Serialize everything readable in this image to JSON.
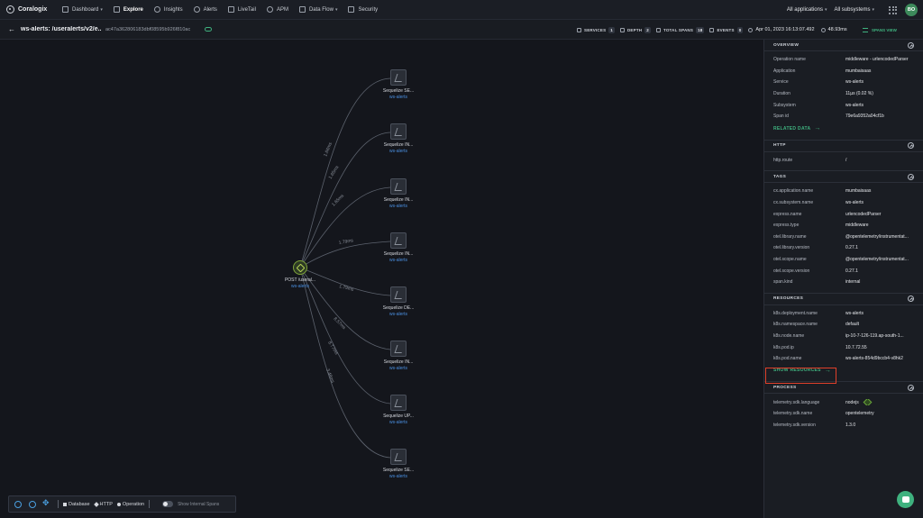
{
  "nav": {
    "logo": "Coralogix",
    "items": [
      {
        "label": "Dashboard",
        "caret": "▾",
        "icon": "grid-icon",
        "active": false
      },
      {
        "label": "Explore",
        "caret": "",
        "icon": "explore-icon",
        "active": true
      },
      {
        "label": "Insights",
        "caret": "",
        "icon": "insights-icon",
        "active": false
      },
      {
        "label": "Alerts",
        "caret": "",
        "icon": "bell-icon",
        "active": false
      },
      {
        "label": "LiveTail",
        "caret": "",
        "icon": "livetail-icon",
        "active": false
      },
      {
        "label": "APM",
        "caret": "",
        "icon": "apm-icon",
        "active": false
      },
      {
        "label": "Data Flow",
        "caret": "▾",
        "icon": "dataflow-icon",
        "active": false
      },
      {
        "label": "Security",
        "caret": "",
        "icon": "shield-icon",
        "active": false
      }
    ],
    "applications": "All applications",
    "subsystems": "All subsystems",
    "avatar": "BO"
  },
  "subbar": {
    "title": "ws-alerts: /useralerts/v2/e...",
    "trace_id": "ac47a362806183dbf08595b926f810ac",
    "services_label": "SERVICES",
    "services_count": "1",
    "depth_label": "DEPTH",
    "depth_count": "2",
    "spans_label": "TOTAL SPANS",
    "spans_count": "18",
    "events_label": "EVENTS",
    "events_count": "0",
    "timestamp": "Apr 01, 2023 16:13:07.492",
    "duration": "48.93ms",
    "spans_view": "SPANS VIEW"
  },
  "graph": {
    "root": {
      "name": "POST /useral...",
      "service": "ws-alerts"
    },
    "children": [
      {
        "name": "Sequelize SE...",
        "service": "ws-alerts",
        "edge_label": "1.66ms"
      },
      {
        "name": "Sequelize IN...",
        "service": "ws-alerts",
        "edge_label": "1.65ms"
      },
      {
        "name": "Sequelize IN...",
        "service": "ws-alerts",
        "edge_label": "1.65ms"
      },
      {
        "name": "Sequelize IN...",
        "service": "ws-alerts",
        "edge_label": "1.79ms"
      },
      {
        "name": "Sequelize DE...",
        "service": "ws-alerts",
        "edge_label": "1.79ms"
      },
      {
        "name": "Sequelize IN...",
        "service": "ws-alerts",
        "edge_label": "8.57ms"
      },
      {
        "name": "Sequelize UP...",
        "service": "ws-alerts",
        "edge_label": "8.77ms"
      },
      {
        "name": "Sequelize SE...",
        "service": "ws-alerts",
        "edge_label": "3.48ms"
      }
    ]
  },
  "toolbar": {
    "legend_database": "Database",
    "legend_http": "HTTP",
    "legend_operation": "Operation",
    "toggle_label": "Show Internal Spans"
  },
  "panel": {
    "overview": {
      "title": "OVERVIEW",
      "rows": [
        {
          "k": "Operation name",
          "v": "middleware - urlencodedParser"
        },
        {
          "k": "Application",
          "v": "mumbaisaas"
        },
        {
          "k": "Service",
          "v": "ws-alerts"
        },
        {
          "k": "Duration",
          "v": "11µs (0.02 %)"
        },
        {
          "k": "Subsystem",
          "v": "ws-alerts"
        },
        {
          "k": "Span id",
          "v": "79e6a9352a04cf1b"
        }
      ],
      "link": "RELATED DATA"
    },
    "http": {
      "title": "HTTP",
      "rows": [
        {
          "k": "http.route",
          "v": "/"
        }
      ]
    },
    "tags": {
      "title": "TAGS",
      "rows": [
        {
          "k": "cx.application.name",
          "v": "mumbaisaas"
        },
        {
          "k": "cx.subsystem.name",
          "v": "ws-alerts"
        },
        {
          "k": "express.name",
          "v": "urlencodedParser"
        },
        {
          "k": "express.type",
          "v": "middleware"
        },
        {
          "k": "otel.library.name",
          "v": "@opentelemetry/instrumentat..."
        },
        {
          "k": "otel.library.version",
          "v": "0.27.1"
        },
        {
          "k": "otel.scope.name",
          "v": "@opentelemetry/instrumentat..."
        },
        {
          "k": "otel.scope.version",
          "v": "0.27.1"
        },
        {
          "k": "span.kind",
          "v": "internal"
        }
      ]
    },
    "resources": {
      "title": "RESOURCES",
      "rows": [
        {
          "k": "k8s.deployment.name",
          "v": "ws-alerts"
        },
        {
          "k": "k8s.namespace.name",
          "v": "default"
        },
        {
          "k": "k8s.node.name",
          "v": "ip-10-7-126-119.ap-south-1..."
        },
        {
          "k": "k8s.pod.ip",
          "v": "10.7.72.55"
        },
        {
          "k": "k8s.pod.name",
          "v": "ws-alerts-854d9bccb4-v8hk2"
        }
      ],
      "link": "SHOW RESOURCES"
    },
    "process": {
      "title": "PROCESS",
      "rows": [
        {
          "k": "telemetry.sdk.language",
          "v": "nodejs"
        },
        {
          "k": "telemetry.sdk.name",
          "v": "opentelemetry"
        },
        {
          "k": "telemetry.sdk.version",
          "v": "1.3.0"
        }
      ]
    }
  },
  "colors": {
    "accent": "#3fb27f",
    "link": "#4a8fe0",
    "highlight": "#e0402a"
  }
}
